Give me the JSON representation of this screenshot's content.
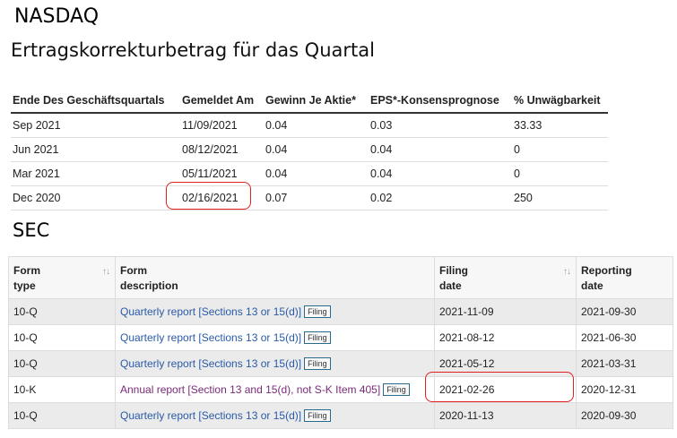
{
  "nasdaq": {
    "heading": "NASDAQ",
    "title": "Ertragskorrekturbetrag für das Quartal",
    "columns": [
      "Ende Des Geschäftsquartals",
      "Gemeldet Am",
      "Gewinn Je Aktie*",
      "EPS*-Konsensprognose",
      "% Unwägbarkeit"
    ],
    "rows": [
      [
        "Sep 2021",
        "11/09/2021",
        "0.04",
        "0.03",
        "33.33"
      ],
      [
        "Jun 2021",
        "08/12/2021",
        "0.04",
        "0.04",
        "0"
      ],
      [
        "Mar 2021",
        "05/11/2021",
        "0.04",
        "0.04",
        "0"
      ],
      [
        "Dec 2020",
        "02/16/2021",
        "0.07",
        "0.02",
        "250"
      ]
    ]
  },
  "sec": {
    "heading": "SEC",
    "columns": [
      {
        "line1": "Form",
        "line2": "type",
        "sortable": true
      },
      {
        "line1": "Form",
        "line2": "description",
        "sortable": false
      },
      {
        "line1": "Filing",
        "line2": "date",
        "sortable": true
      },
      {
        "line1": "Reporting",
        "line2": "date",
        "sortable": false
      }
    ],
    "sort_glyph": "↑↓",
    "rows": [
      {
        "type": "10-Q",
        "description": "Quarterly report [Sections 13 or 15(d)]",
        "tag": "Filing",
        "filing_date": "2021-11-09",
        "reporting_date": "2021-09-30"
      },
      {
        "type": "10-Q",
        "description": "Quarterly report [Sections 13 or 15(d)]",
        "tag": "Filing",
        "filing_date": "2021-08-12",
        "reporting_date": "2021-06-30"
      },
      {
        "type": "10-Q",
        "description": "Quarterly report [Sections 13 or 15(d)]",
        "tag": "Filing",
        "filing_date": "2021-05-12",
        "reporting_date": "2021-03-31"
      },
      {
        "type": "10-K",
        "description": "Annual report [Section 13 and 15(d), not S-K Item 405]",
        "tag": "Filing",
        "filing_date": "2021-02-26",
        "reporting_date": "2020-12-31"
      },
      {
        "type": "10-Q",
        "description": "Quarterly report [Sections 13 or 15(d)]",
        "tag": "Filing",
        "filing_date": "2020-11-13",
        "reporting_date": "2020-09-30"
      }
    ]
  },
  "colors": {
    "highlight": "#e02020",
    "link": "#2a5aa8",
    "visited": "#7a2a7a"
  }
}
